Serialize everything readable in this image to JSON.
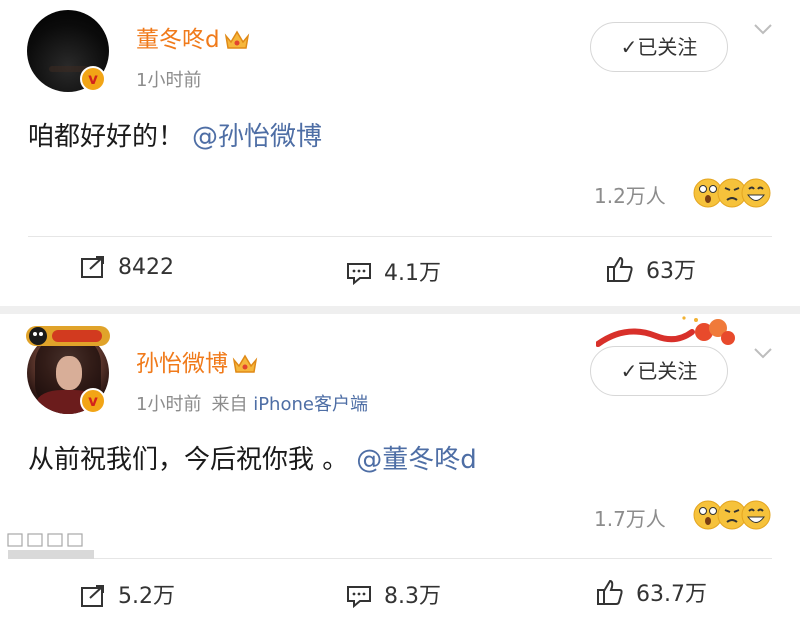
{
  "posts": [
    {
      "author": "董冬咚d",
      "time": "1小时前",
      "follow_label": "已关注",
      "text": "咱都好好的！",
      "mention": "@孙怡微博",
      "reaction_count": "1.2万人",
      "reposts": "8422",
      "comments": "4.1万",
      "likes": "63万"
    },
    {
      "author": "孙怡微博",
      "time": "1小时前",
      "source_prefix": "来自",
      "source_device": "iPhone客户端",
      "follow_label": "已关注",
      "text": "从前祝我们，今后祝你我 。",
      "mention": "@董冬咚d",
      "reaction_count": "1.7万人",
      "reposts": "5.2万",
      "comments": "8.3万",
      "likes": "63.7万"
    }
  ],
  "colors": {
    "name": "#f07a1a",
    "link": "#4e6ea5",
    "muted": "#8c8c8c",
    "vip_badge": "#f2a516"
  },
  "icons": {
    "repost": "repost-icon",
    "comment": "comment-icon",
    "like": "thumbs-up-icon",
    "crown": "vip-crown-icon",
    "verified": "verified-v-icon"
  }
}
